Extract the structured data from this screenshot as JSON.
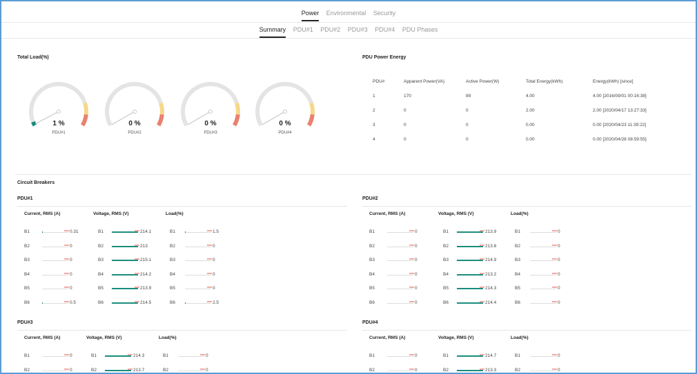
{
  "nav": {
    "top_tabs": [
      {
        "label": "Power",
        "active": true
      },
      {
        "label": "Environmental",
        "active": false
      },
      {
        "label": "Security",
        "active": false
      }
    ],
    "sub_tabs": [
      {
        "label": "Summary",
        "active": true
      },
      {
        "label": "PDU#1",
        "active": false
      },
      {
        "label": "PDU#2",
        "active": false
      },
      {
        "label": "PDU#3",
        "active": false
      },
      {
        "label": "PDU#4",
        "active": false
      },
      {
        "label": "PDU Phases",
        "active": false
      }
    ]
  },
  "total_load": {
    "title": "Total Load(%)",
    "gauges": [
      {
        "value": "1 %",
        "percent": 1,
        "label": "PDU#1"
      },
      {
        "value": "0 %",
        "percent": 0,
        "label": "PDU#2"
      },
      {
        "value": "0 %",
        "percent": 0,
        "label": "PDU#3"
      },
      {
        "value": "0 %",
        "percent": 0,
        "label": "PDU#4"
      }
    ]
  },
  "energy": {
    "title": "PDU Power Energy",
    "headers": [
      "PDU#",
      "Apparent Power(VA)",
      "Active Power(W)",
      "Total Energy(kWh)",
      "Energy(kWh) [since]"
    ],
    "rows": [
      [
        "1",
        "170",
        "89",
        "4.00",
        "4.00 [2016/09/01 00:16:38]"
      ],
      [
        "2",
        "0",
        "0",
        "2.00",
        "2.00 [2020/04/17 13:27:33]"
      ],
      [
        "3",
        "0",
        "0",
        "0.00",
        "0.00 [2020/04/23 11:39:22]"
      ],
      [
        "4",
        "0",
        "0",
        "0.00",
        "0.00 [2020/04/28 08:59:55]"
      ]
    ]
  },
  "circuit_breakers": {
    "title": "Circuit Breakers",
    "headers": {
      "current": "Current, RMS (A)",
      "voltage": "Voltage, RMS (V)",
      "load": "Load(%)"
    },
    "pdus": [
      {
        "name": "PDU#1",
        "rows": [
          {
            "b": "B1",
            "current": "0.31",
            "current_frac": 0.01,
            "voltage": "214.1",
            "load": "1.5",
            "load_frac": 0.015
          },
          {
            "b": "B2",
            "current": "0",
            "current_frac": 0,
            "voltage": "213",
            "load": "0",
            "load_frac": 0
          },
          {
            "b": "B3",
            "current": "0",
            "current_frac": 0,
            "voltage": "215.1",
            "load": "0",
            "load_frac": 0
          },
          {
            "b": "B4",
            "current": "0",
            "current_frac": 0,
            "voltage": "214.2",
            "load": "0",
            "load_frac": 0
          },
          {
            "b": "B5",
            "current": "0",
            "current_frac": 0,
            "voltage": "213.9",
            "load": "0",
            "load_frac": 0
          },
          {
            "b": "B6",
            "current": "0.5",
            "current_frac": 0.02,
            "voltage": "214.5",
            "load": "2.5",
            "load_frac": 0.025
          }
        ]
      },
      {
        "name": "PDU#2",
        "rows": [
          {
            "b": "B1",
            "current": "0",
            "current_frac": 0,
            "voltage": "213.9",
            "load": "0",
            "load_frac": 0
          },
          {
            "b": "B2",
            "current": "0",
            "current_frac": 0,
            "voltage": "213.8",
            "load": "0",
            "load_frac": 0
          },
          {
            "b": "B3",
            "current": "0",
            "current_frac": 0,
            "voltage": "214.9",
            "load": "0",
            "load_frac": 0
          },
          {
            "b": "B4",
            "current": "0",
            "current_frac": 0,
            "voltage": "213.2",
            "load": "0",
            "load_frac": 0
          },
          {
            "b": "B5",
            "current": "0",
            "current_frac": 0,
            "voltage": "214.3",
            "load": "0",
            "load_frac": 0
          },
          {
            "b": "B6",
            "current": "0",
            "current_frac": 0,
            "voltage": "214.4",
            "load": "0",
            "load_frac": 0
          }
        ]
      },
      {
        "name": "PDU#3",
        "rows": [
          {
            "b": "B1",
            "current": "0",
            "current_frac": 0,
            "voltage": "214.3",
            "load": "0",
            "load_frac": 0
          },
          {
            "b": "B2",
            "current": "0",
            "current_frac": 0,
            "voltage": "213.7",
            "load": "0",
            "load_frac": 0
          }
        ]
      },
      {
        "name": "PDU#4",
        "rows": [
          {
            "b": "B1",
            "current": "0",
            "current_frac": 0,
            "voltage": "214.7",
            "load": "0",
            "load_frac": 0
          },
          {
            "b": "B2",
            "current": "0",
            "current_frac": 0,
            "voltage": "213.3",
            "load": "0",
            "load_frac": 0
          }
        ]
      }
    ]
  },
  "colors": {
    "accent": "#1a8c7c",
    "gauge_track": "#e4e4e4",
    "gauge_warn": "#f5d88a",
    "gauge_crit": "#e8826e",
    "bar_tick": "#f1a9a0"
  }
}
